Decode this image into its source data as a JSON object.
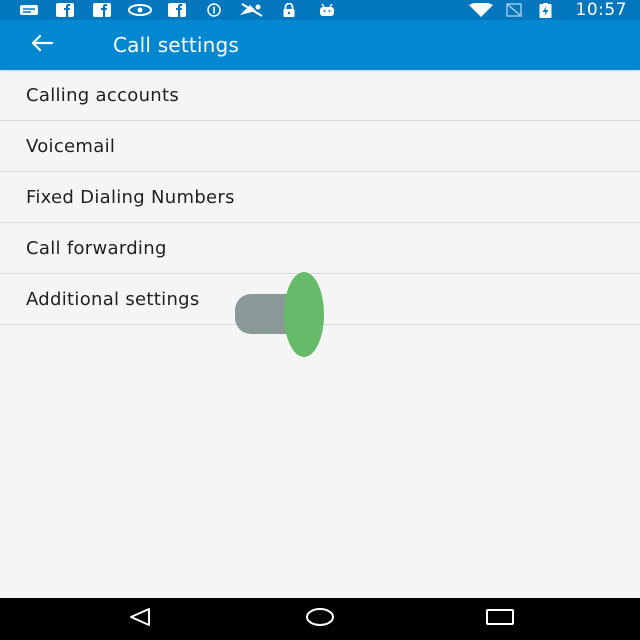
{
  "status_bar": {
    "time": "10:57",
    "left_icons": [
      "notification-icon",
      "facebook-icon",
      "facebook-icon",
      "eye-icon",
      "facebook-icon",
      "info-icon",
      "no-signal-icon",
      "lock-icon",
      "android-icon"
    ],
    "right_icons": [
      "wifi-icon",
      "sim-icon",
      "battery-charging-icon"
    ],
    "background": "#0277bd"
  },
  "app_bar": {
    "title": "Call settings",
    "background": "#0288d1",
    "back_icon": "arrow-back-icon"
  },
  "settings": [
    {
      "label": "Calling accounts"
    },
    {
      "label": "Voicemail"
    },
    {
      "label": "Fixed Dialing Numbers"
    },
    {
      "label": "Call forwarding"
    },
    {
      "label": "Additional settings"
    }
  ],
  "overlay": {
    "handle_color": "#8a9a98",
    "dot_color": "#66bb6a"
  },
  "nav_bar": {
    "back_icon": "nav-back-icon",
    "home_icon": "nav-home-icon",
    "recents_icon": "nav-recents-icon"
  }
}
